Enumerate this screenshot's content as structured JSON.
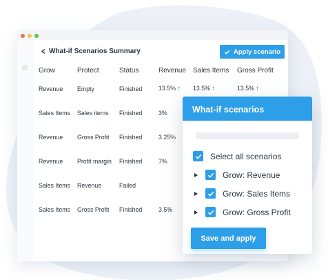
{
  "summary": {
    "title": "What-if Scenarios Summary",
    "apply_label": "Apply scenario",
    "columns": [
      "Grow",
      "Protect",
      "Status",
      "Revenue",
      "Sales Items",
      "Gross Profit"
    ],
    "rows": [
      {
        "grow": "Revenue",
        "protect": "Empty",
        "status": "Finished",
        "revenue": "13.5%",
        "sales_items": "13.5%",
        "gross_profit": "13.5%",
        "revenue_up": "↑",
        "sales_items_up": "↑",
        "gross_profit_up": "↑"
      },
      {
        "grow": "Sales Items",
        "protect": "Sales items",
        "status": "Finished",
        "revenue": "3%",
        "sales_items": "",
        "gross_profit": "",
        "revenue_up": "",
        "sales_items_up": "",
        "gross_profit_up": ""
      },
      {
        "grow": "Revenue",
        "protect": "Gross Profit",
        "status": "Finished",
        "revenue": "3.25%",
        "sales_items": "",
        "gross_profit": "",
        "revenue_up": "",
        "sales_items_up": "",
        "gross_profit_up": ""
      },
      {
        "grow": "Revenue",
        "protect": "Profit margin",
        "status": "Finished",
        "revenue": "7%",
        "sales_items": "",
        "gross_profit": "",
        "revenue_up": "",
        "sales_items_up": "",
        "gross_profit_up": ""
      },
      {
        "grow": "Sales Items",
        "protect": "Revenue",
        "status": "Failed",
        "revenue": "",
        "sales_items": "",
        "gross_profit": "",
        "revenue_up": "",
        "sales_items_up": "",
        "gross_profit_up": ""
      },
      {
        "grow": "Sales Items",
        "protect": "Gross Profit",
        "status": "Finished",
        "revenue": "3.5%",
        "sales_items": "",
        "gross_profit": "",
        "revenue_up": "",
        "sales_items_up": "",
        "gross_profit_up": ""
      }
    ]
  },
  "panel": {
    "title": "What-if scenarios",
    "select_all_label": "Select all scenarios",
    "scenarios": [
      "Grow: Revenue",
      "Grow: Sales Items",
      "Grow: Gross Profit"
    ],
    "save_label": "Save and apply"
  },
  "colors": {
    "accent": "#2d9ee8",
    "increase": "#27a845",
    "failed": "#d9534f",
    "backdrop": "#edf1f7"
  },
  "icons": [
    "back-arrow-icon",
    "check-icon",
    "up-arrow-icon",
    "expand-caret-icon"
  ]
}
